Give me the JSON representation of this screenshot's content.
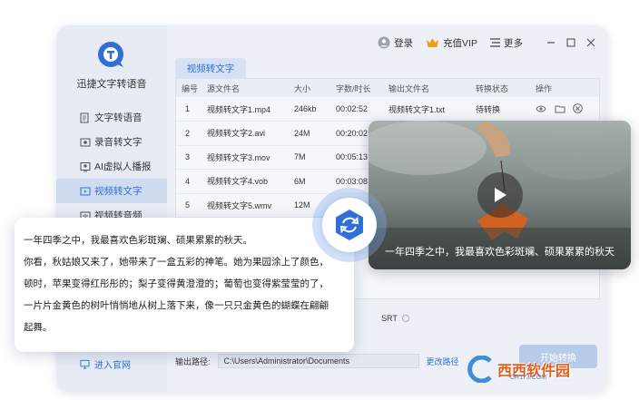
{
  "app": {
    "title": "迅捷文字转语音"
  },
  "sidebar": {
    "items": [
      {
        "label": "文字转语音"
      },
      {
        "label": "录音转文字"
      },
      {
        "label": "AI虚拟人播报"
      },
      {
        "label": "视频转文字"
      },
      {
        "label": "视频转音频"
      }
    ],
    "bottom_link": "进入官网"
  },
  "topbar": {
    "login": "登录",
    "vip": "充值VIP",
    "more": "更多"
  },
  "tab": {
    "label": "视频转文字"
  },
  "table": {
    "headers": [
      "编号",
      "源文件名",
      "大小",
      "字数/时长",
      "输出文件名",
      "转换状态",
      "操作"
    ],
    "rows": [
      {
        "num": "1",
        "name": "视频转文字1.mp4",
        "size": "246kb",
        "dur": "00:02:52",
        "out": "视频转文字1.txt",
        "status": "待转换"
      },
      {
        "num": "2",
        "name": "视频转文字2.avi",
        "size": "24M",
        "dur": "00:20:02",
        "out": "",
        "status": ""
      },
      {
        "num": "3",
        "name": "视频转文字3.mov",
        "size": "7M",
        "dur": "00:05:13",
        "out": "",
        "status": ""
      },
      {
        "num": "4",
        "name": "视频转文字4.vob",
        "size": "6M",
        "dur": "00:03:08",
        "out": "",
        "status": ""
      },
      {
        "num": "5",
        "name": "视频转文字5.wmv",
        "size": "12M",
        "dur": "",
        "out": "",
        "status": ""
      }
    ]
  },
  "options": {
    "srt": "SRT"
  },
  "output": {
    "label": "输出路径:",
    "path": "C:\\Users\\Administrator\\Documents",
    "change": "更改路径"
  },
  "start_button": "开始转换",
  "text_card": {
    "lines": [
      "一年四季之中，我最喜欢色彩斑斓、硕果累累的秋天。",
      "你看，秋姑娘又来了，她带来了一盒五彩的神笔。她为果园涂上了颜色，",
      "顿时，苹果变得红彤彤的；梨子变得黄澄澄的；葡萄也变得紫莹莹的了，",
      "一片片金黄色的树叶悄悄地从树上落下来，像一只只金黄色的蝴蝶在翩翩",
      "起舞。"
    ]
  },
  "video": {
    "subtitle": "一年四季之中，我最喜欢色彩斑斓、硕果累累的秋天"
  },
  "watermark": {
    "text": "西西软件园",
    "sub": "CR173.COM"
  },
  "colors": {
    "accent": "#2f6fd6",
    "sidebar_active": "#cfdcf0",
    "vip_gold": "#e8a317",
    "watermark": "#e95d1c"
  }
}
